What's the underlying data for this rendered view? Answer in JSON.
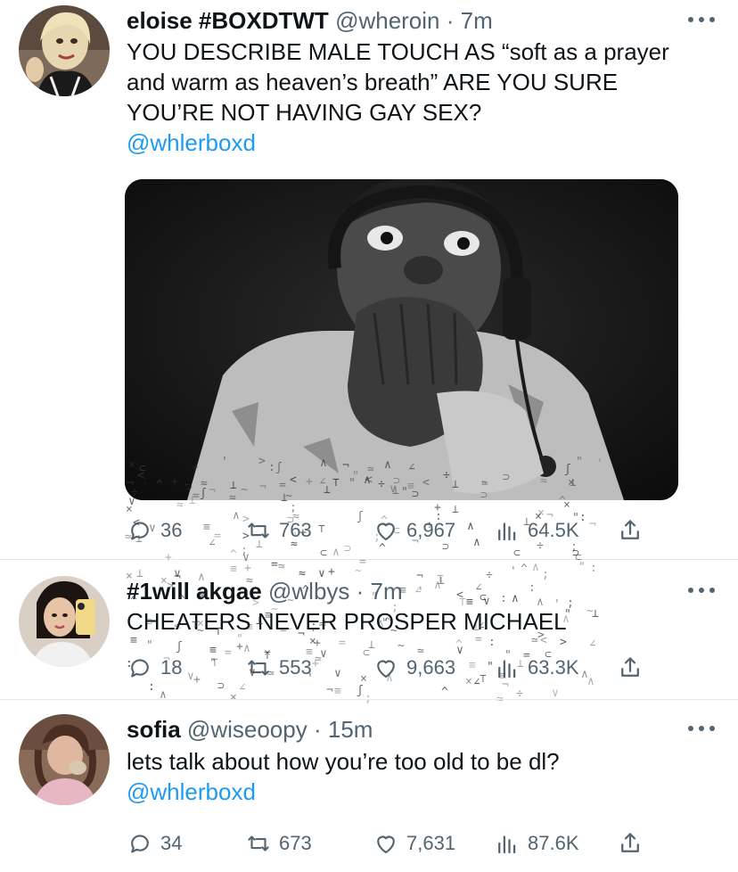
{
  "tweets": [
    {
      "name": "eloise #BOXDTWT",
      "handle": "@wheroin",
      "dot": "·",
      "time": "7m",
      "text": "YOU DESCRIBE MALE TOUCH AS “soft as a prayer and warm as heaven’s breath” ARE YOU SURE YOU’RE NOT HAVING GAY SEX?",
      "mention": "@whlerboxd",
      "replies": "36",
      "retweets": "763",
      "likes": "6,967",
      "views": "64.5K"
    },
    {
      "name": "#1will akgae",
      "handle": "@wlbys",
      "dot": "·",
      "time": "7m",
      "text": "CHEATERS NEVER PROSPER MICHAEL",
      "replies": "18",
      "retweets": "553",
      "likes": "9,663",
      "views": "63.3K"
    },
    {
      "name": "sofia",
      "handle": "@wiseoopy",
      "dot": "·",
      "time": "15m",
      "text": "lets talk about how you’re too old to be dl?",
      "mention": "@whlerboxd",
      "replies": "34",
      "retweets": "673",
      "likes": "7,631",
      "views": "87.6K"
    }
  ],
  "colors": {
    "accent": "#1d9bf0",
    "secondary_text": "#536471",
    "primary_text": "#0f1419",
    "divider": "#e6e8ea"
  },
  "icons": [
    "reply-icon",
    "retweet-icon",
    "like-icon",
    "views-icon",
    "share-icon",
    "more-icon"
  ]
}
